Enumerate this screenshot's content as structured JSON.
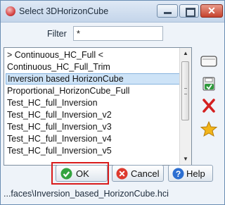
{
  "window": {
    "title": "Select 3DHorizonCube",
    "controls": {
      "minimize": "minimize",
      "maximize": "maximize",
      "close": "✕"
    }
  },
  "filter": {
    "label": "Filter",
    "value": "*"
  },
  "list": {
    "items": [
      "> Continuous_HC_Full <",
      "Continuous_HC_Full_Trim",
      "Inversion based HorizonCube",
      "Proportional_HorizonCube_Full",
      "Test_HC_full_Inversion",
      "Test_HC_full_Inversion_v2",
      "Test_HC_full_Inversion_v3",
      "Test_HC_full_Inversion_v4",
      "Test_HC_full_Inversion_v5"
    ],
    "selected_index": 2,
    "scroll_up": "▲",
    "scroll_down": "▼"
  },
  "side_buttons": [
    "rename-icon",
    "save-icon",
    "remove-icon",
    "default-star-icon"
  ],
  "buttons": {
    "ok": "OK",
    "cancel": "Cancel",
    "help": "Help"
  },
  "status": {
    "path": "...faces\\Inversion_based_HorizonCube.hci"
  },
  "colors": {
    "selection": "#cde3f7",
    "ok_highlight": "#d91c1c",
    "close_button": "#c5422d"
  }
}
